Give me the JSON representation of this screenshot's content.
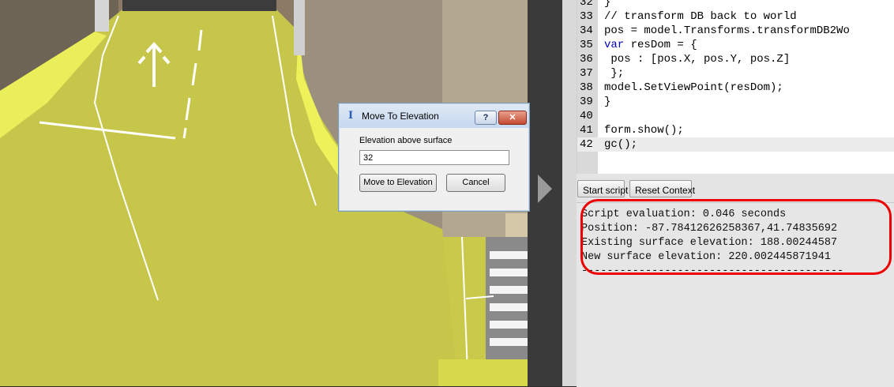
{
  "colors": {
    "ground": "#c9c94b",
    "road": "#3a3a3a",
    "highlight": "#ee0000",
    "keyword": "#0000c0",
    "comment": "#8a8a8a"
  },
  "dialog": {
    "title": "Move To Elevation",
    "icon": "app-info-icon",
    "help_label": "?",
    "close_label": "✕",
    "field_label": "Elevation above surface",
    "field_value": "32",
    "move_button": "Move to Elevation",
    "cancel_button": "Cancel"
  },
  "editor": {
    "lines": [
      {
        "num": "32",
        "text": "}"
      },
      {
        "num": "33",
        "text": "// transform DB back to world"
      },
      {
        "num": "34",
        "text": "pos = model.Transforms.transformDB2Wo"
      },
      {
        "num": "35",
        "text": "var resDom = {"
      },
      {
        "num": "36",
        "text": " pos : [pos.X, pos.Y, pos.Z]"
      },
      {
        "num": "37",
        "text": " };"
      },
      {
        "num": "38",
        "text": "model.SetViewPoint(resDom);"
      },
      {
        "num": "39",
        "text": "}"
      },
      {
        "num": "40",
        "text": ""
      },
      {
        "num": "41",
        "text": "form.show();"
      },
      {
        "num": "42",
        "text": "gc();"
      }
    ]
  },
  "toolbar": {
    "start_script": "Start script",
    "reset_context": "Reset Context"
  },
  "output": {
    "lines": [
      "Script evaluation: 0.046 seconds",
      "Position: -87.78412626258367,41.74835692",
      "Existing surface elevation: 188.00244587",
      "New surface elevation: 220.002445871941",
      "-----------------------------------------"
    ]
  }
}
